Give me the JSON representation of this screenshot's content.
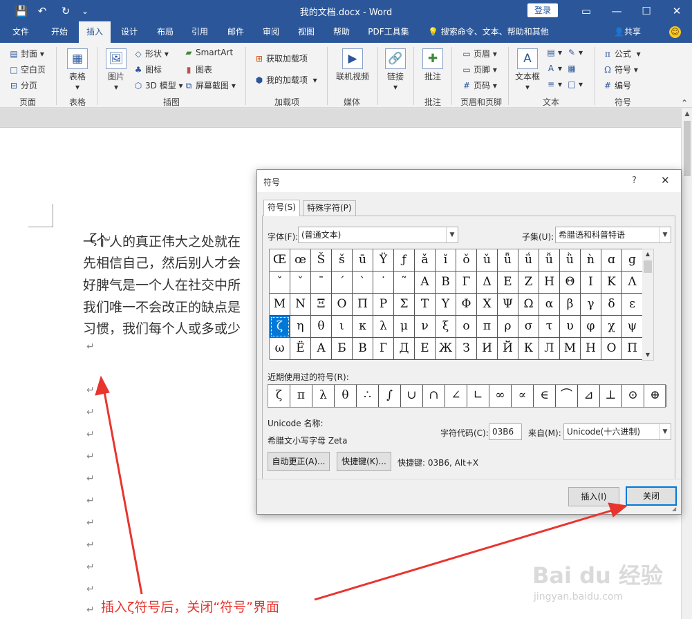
{
  "titlebar": {
    "doc_title": "我的文档.docx  -  Word",
    "login": "登录",
    "save_icon": "💾",
    "undo_icon": "↶",
    "redo_icon": "↻",
    "customize_icon": "⌄",
    "minimize": "—",
    "restore": "☐",
    "close": "✕"
  },
  "tabs": [
    "文件",
    "开始",
    "插入",
    "设计",
    "布局",
    "引用",
    "邮件",
    "审阅",
    "视图",
    "帮助",
    "PDF工具集"
  ],
  "tell_me": "搜索命令、文本、帮助和其他",
  "share": "共享",
  "ribbon": {
    "pages": {
      "cover": "封面",
      "blank": "空白页",
      "break": "分页",
      "label": "页面"
    },
    "tables": {
      "table": "表格",
      "label": "表格"
    },
    "illustrations": {
      "picture": "图片",
      "shapes": "形状",
      "icons": "图标",
      "model3d": "3D 模型",
      "smartart": "SmartArt",
      "chart": "图表",
      "screenshot": "屏幕截图",
      "label": "插图"
    },
    "addins": {
      "get": "获取加载项",
      "mine": "我的加载项",
      "label": "加载项"
    },
    "media": {
      "video": "联机视频",
      "label": "媒体"
    },
    "links": {
      "link": "链接"
    },
    "comments": {
      "comment": "批注",
      "label": "批注"
    },
    "headerfooter": {
      "header": "页眉",
      "footer": "页脚",
      "pagenum": "页码",
      "label": "页眉和页脚"
    },
    "text": {
      "textbox": "文本框",
      "label": "文本"
    },
    "symbols": {
      "equation": "公式",
      "symbol": "符号",
      "number": "编号",
      "label": "符号"
    }
  },
  "document": {
    "lines": [
      "一个人的真正伟大之处就在",
      "先相信自己，然后别人才会",
      "好脾气是一个人在社交中所",
      "我们唯一不会改正的缺点是",
      "习惯，我们每个人或多或少"
    ],
    "inserted_symbol": "ζ",
    "para_mark": "↵"
  },
  "dialog": {
    "title": "符号",
    "help": "?",
    "close": "✕",
    "tab_symbols": "符号(S)",
    "tab_special": "特殊字符(P)",
    "font_label": "字体(F):",
    "font_value": "(普通文本)",
    "subset_label": "子集(U):",
    "subset_value": "希腊语和科普特语",
    "grid": [
      [
        "Œ",
        "œ",
        "Š",
        "š",
        "ū",
        "Ÿ",
        "ƒ",
        "ǎ",
        "ǐ",
        "ǒ",
        "ǔ",
        "ǖ",
        "ǘ",
        "ǚ",
        "ǜ",
        "ǹ",
        "ɑ",
        "ɡ"
      ],
      [
        "ˇ",
        "ˇ",
        "ˉ",
        "ˊ",
        "ˋ",
        "˙",
        "˜",
        "Α",
        "Β",
        "Γ",
        "Δ",
        "Ε",
        "Ζ",
        "Η",
        "Θ",
        "Ι",
        "Κ",
        "Λ"
      ],
      [
        "Μ",
        "Ν",
        "Ξ",
        "Ο",
        "Π",
        "Ρ",
        "Σ",
        "Τ",
        "Υ",
        "Φ",
        "Χ",
        "Ψ",
        "Ω",
        "α",
        "β",
        "γ",
        "δ",
        "ε"
      ],
      [
        "ζ",
        "η",
        "θ",
        "ι",
        "κ",
        "λ",
        "μ",
        "ν",
        "ξ",
        "ο",
        "π",
        "ρ",
        "σ",
        "τ",
        "υ",
        "φ",
        "χ",
        "ψ"
      ],
      [
        "ω",
        "Ё",
        "А",
        "Б",
        "В",
        "Г",
        "Д",
        "Е",
        "Ж",
        "З",
        "И",
        "Й",
        "К",
        "Л",
        "М",
        "Н",
        "О",
        "П"
      ]
    ],
    "recent_label": "近期使用过的符号(R):",
    "recent": [
      "ζ",
      "π",
      "λ",
      "θ",
      "∴",
      "∫",
      "∪",
      "∩",
      "∠",
      "∟",
      "∞",
      "∝",
      "∈",
      "⌒",
      "⊿",
      "⊥",
      "⊙",
      "⊕"
    ],
    "unicode_name_label": "Unicode 名称:",
    "unicode_name": "希腊文小写字母 Zeta",
    "charcode_label": "字符代码(C):",
    "charcode": "03B6",
    "from_label": "来自(M):",
    "from_value": "Unicode(十六进制)",
    "autocorrect": "自动更正(A)...",
    "shortcut_key": "快捷键(K)...",
    "shortcut_text": "快捷键: 03B6, Alt+X",
    "insert": "插入(I)",
    "close_btn": "关闭"
  },
  "annotation": "插入ζ符号后，关闭“符号”界面",
  "watermark": {
    "logo": "Bai du 经验",
    "url": "jingyan.baidu.com"
  },
  "colors": {
    "accent": "#2b579a",
    "selection": "#0078d7",
    "annotation": "#e8352e"
  }
}
